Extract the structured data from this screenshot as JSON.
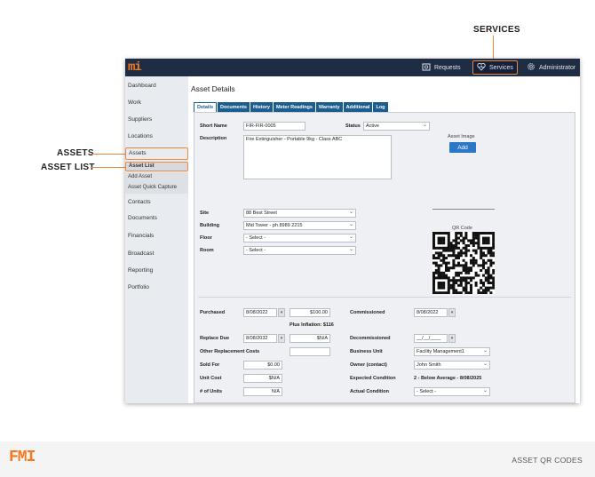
{
  "callouts": {
    "services": "SERVICES",
    "assets": "ASSETS",
    "asset_list": "ASSET LIST"
  },
  "app": {
    "logo": "mi"
  },
  "topbar": {
    "requests": "Requests",
    "services": "Services",
    "administrator": "Administrator"
  },
  "sidebar": {
    "dashboard": "Dashboard",
    "work": "Work",
    "suppliers": "Suppliers",
    "locations": "Locations",
    "assets": "Assets",
    "asset_list": "Asset List",
    "add_asset": "Add Asset",
    "asset_quick_capture": "Asset Quick Capture",
    "contacts": "Contacts",
    "documents": "Documents",
    "financials": "Financials",
    "broadcast": "Broadcast",
    "reporting": "Reporting",
    "portfolio": "Portfolio"
  },
  "page": {
    "title": "Asset Details"
  },
  "tabs": [
    "Details",
    "Documents",
    "History",
    "Meter Readings",
    "Warranty",
    "Additional",
    "Log"
  ],
  "form": {
    "short_name_label": "Short Name",
    "short_name": "FIR-FIR-0005",
    "status_label": "Status",
    "status": "Active",
    "description_label": "Description",
    "description": "Fire Extinguisher - Portable  9kg - Class ABC",
    "asset_image_label": "Asset Image",
    "add_label": "Add",
    "site_label": "Site",
    "site": "88 Best Street",
    "building_label": "Building",
    "building": "Mid Tower - ph 8989 2215",
    "floor_label": "Floor",
    "floor": "- Select -",
    "room_label": "Room",
    "room": "- Select -",
    "qr_label": "QR Code",
    "purchased_label": "Purchased",
    "purchased": "8/08/2022",
    "purchased_amount": "$100.00",
    "plus_inflation": "Plus Inflation: $116",
    "commissioned_label": "Commissioned",
    "commissioned": "8/08/2022",
    "replace_due_label": "Replace Due",
    "replace_due": "8/08/2032",
    "replace_amount": "$N/A",
    "decommissioned_label": "Decommissioned",
    "decommissioned": "__/__/____",
    "other_costs_label": "Other Replacement Costs",
    "business_unit_label": "Business Unit",
    "business_unit": "Facility Management1",
    "sold_for_label": "Sold For",
    "sold_for": "$0.00",
    "owner_label": "Owner (contact)",
    "owner": "John Smith",
    "unit_cost_label": "Unit Cost",
    "unit_cost": "$N/A",
    "expected_condition_label": "Expected Condition",
    "expected_condition": "2 - Below Average - 8/08/2025",
    "units_label": "# of Units",
    "units": "N/A",
    "actual_condition_label": "Actual Condition",
    "actual_condition": "- Select -"
  },
  "footer": {
    "logo": "FMI",
    "caption": "ASSET QR CODES"
  },
  "colors": {
    "accent": "#f0883a",
    "topbar": "#1f2d44",
    "tab": "#1b5d8f",
    "button": "#2a78c6",
    "brand": "#f47a20"
  }
}
